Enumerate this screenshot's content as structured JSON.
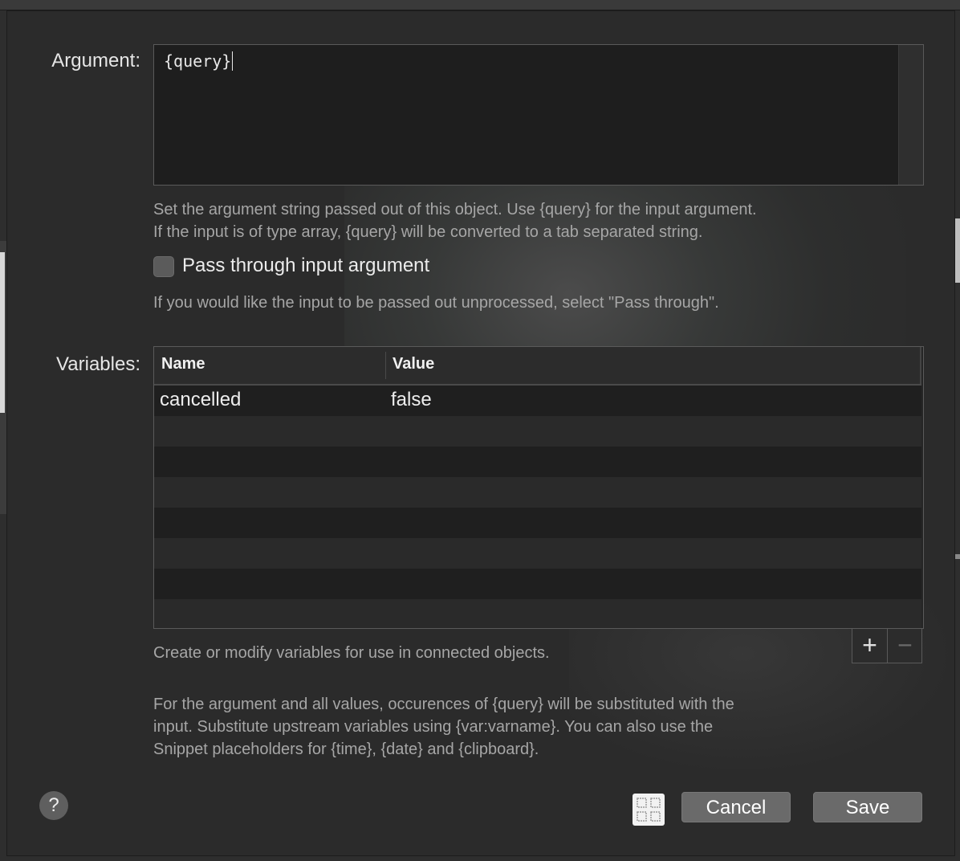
{
  "argument": {
    "label": "Argument:",
    "value": "{query}",
    "help_line1": "Set the argument string passed out of this object. Use {query} for the input argument.",
    "help_line2": "If the input is of type array, {query} will be converted to a tab separated string."
  },
  "pass_through": {
    "label": "Pass through input argument",
    "checked": false,
    "help": "If you would like the input to be passed out unprocessed, select \"Pass through\"."
  },
  "variables": {
    "label": "Variables:",
    "columns": [
      "Name",
      "Value"
    ],
    "rows": [
      {
        "name": "cancelled",
        "value": "false"
      }
    ],
    "help": "Create or modify variables for use in connected objects.",
    "add_label": "+",
    "remove_label": "−"
  },
  "footer_note": {
    "line1": "For the argument and all values, occurences of {query} will be substituted with the",
    "line2": "input. Substitute upstream variables using {var:varname}. You can also use the",
    "line3": "Snippet placeholders for {time}, {date} and {clipboard}."
  },
  "buttons": {
    "help": "?",
    "cancel": "Cancel",
    "save": "Save"
  },
  "icons": {
    "help": "question-mark-icon",
    "grid": "grid-icon",
    "add": "plus-icon",
    "remove": "minus-icon"
  }
}
